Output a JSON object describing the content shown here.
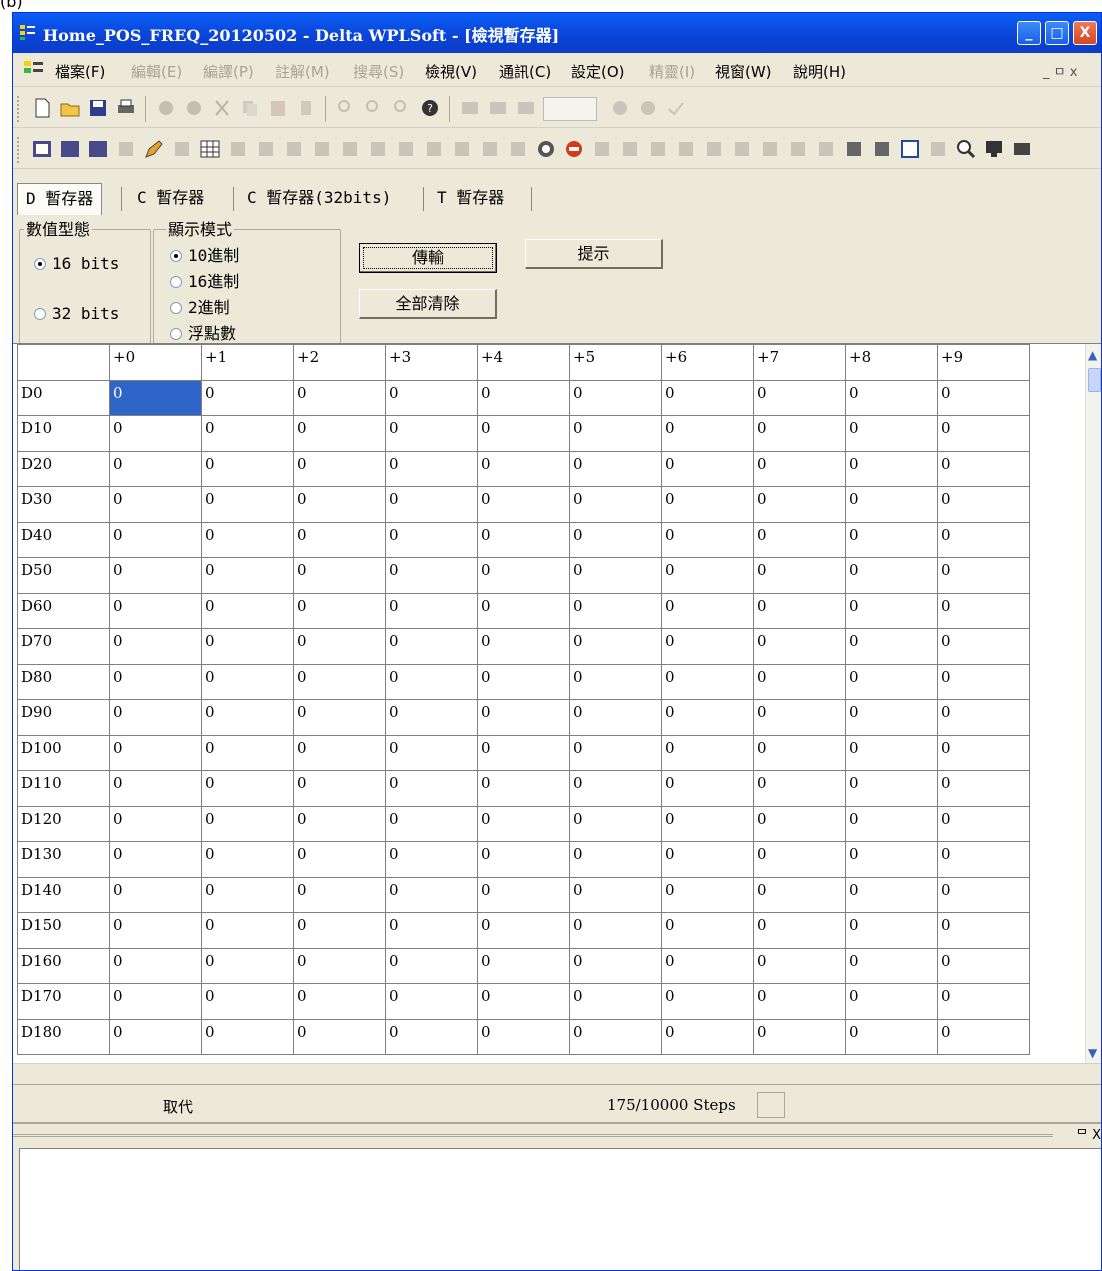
{
  "figure_label": "(b)",
  "window": {
    "title": "Home_POS_FREQ_20120502 - Delta WPLSoft - [檢視暫存器]",
    "controls": {
      "minimize": "_",
      "maximize": "□",
      "close": "X"
    }
  },
  "menu": {
    "items": [
      {
        "label": "檔案(F)",
        "enabled": true
      },
      {
        "label": "編輯(E)",
        "enabled": false
      },
      {
        "label": "編譯(P)",
        "enabled": false
      },
      {
        "label": "註解(M)",
        "enabled": false
      },
      {
        "label": "搜尋(S)",
        "enabled": false
      },
      {
        "label": "檢視(V)",
        "enabled": true
      },
      {
        "label": "通訊(C)",
        "enabled": true
      },
      {
        "label": "設定(O)",
        "enabled": true
      },
      {
        "label": "精靈(I)",
        "enabled": false
      },
      {
        "label": "視窗(W)",
        "enabled": true
      },
      {
        "label": "說明(H)",
        "enabled": true
      }
    ],
    "mdi_controls": "_ ㅁ x"
  },
  "tabs": [
    "D 暫存器",
    "C 暫存器",
    "C 暫存器(32bits)",
    "T 暫存器"
  ],
  "value_type": {
    "title": "數值型態",
    "options": [
      "16 bits",
      "32 bits"
    ],
    "selected": 0
  },
  "display_mode": {
    "title": "顯示模式",
    "options": [
      "10進制",
      "16進制",
      "2進制",
      "浮點數"
    ],
    "selected": 0
  },
  "buttons": {
    "transfer": "傳輸",
    "hint": "提示",
    "clear_all": "全部清除"
  },
  "grid": {
    "columns": [
      "+0",
      "+1",
      "+2",
      "+3",
      "+4",
      "+5",
      "+6",
      "+7",
      "+8",
      "+9"
    ],
    "rows": [
      {
        "label": "D0",
        "values": [
          "0",
          "0",
          "0",
          "0",
          "0",
          "0",
          "0",
          "0",
          "0",
          "0"
        ]
      },
      {
        "label": "D10",
        "values": [
          "0",
          "0",
          "0",
          "0",
          "0",
          "0",
          "0",
          "0",
          "0",
          "0"
        ]
      },
      {
        "label": "D20",
        "values": [
          "0",
          "0",
          "0",
          "0",
          "0",
          "0",
          "0",
          "0",
          "0",
          "0"
        ]
      },
      {
        "label": "D30",
        "values": [
          "0",
          "0",
          "0",
          "0",
          "0",
          "0",
          "0",
          "0",
          "0",
          "0"
        ]
      },
      {
        "label": "D40",
        "values": [
          "0",
          "0",
          "0",
          "0",
          "0",
          "0",
          "0",
          "0",
          "0",
          "0"
        ]
      },
      {
        "label": "D50",
        "values": [
          "0",
          "0",
          "0",
          "0",
          "0",
          "0",
          "0",
          "0",
          "0",
          "0"
        ]
      },
      {
        "label": "D60",
        "values": [
          "0",
          "0",
          "0",
          "0",
          "0",
          "0",
          "0",
          "0",
          "0",
          "0"
        ]
      },
      {
        "label": "D70",
        "values": [
          "0",
          "0",
          "0",
          "0",
          "0",
          "0",
          "0",
          "0",
          "0",
          "0"
        ]
      },
      {
        "label": "D80",
        "values": [
          "0",
          "0",
          "0",
          "0",
          "0",
          "0",
          "0",
          "0",
          "0",
          "0"
        ]
      },
      {
        "label": "D90",
        "values": [
          "0",
          "0",
          "0",
          "0",
          "0",
          "0",
          "0",
          "0",
          "0",
          "0"
        ]
      },
      {
        "label": "D100",
        "values": [
          "0",
          "0",
          "0",
          "0",
          "0",
          "0",
          "0",
          "0",
          "0",
          "0"
        ]
      },
      {
        "label": "D110",
        "values": [
          "0",
          "0",
          "0",
          "0",
          "0",
          "0",
          "0",
          "0",
          "0",
          "0"
        ]
      },
      {
        "label": "D120",
        "values": [
          "0",
          "0",
          "0",
          "0",
          "0",
          "0",
          "0",
          "0",
          "0",
          "0"
        ]
      },
      {
        "label": "D130",
        "values": [
          "0",
          "0",
          "0",
          "0",
          "0",
          "0",
          "0",
          "0",
          "0",
          "0"
        ]
      },
      {
        "label": "D140",
        "values": [
          "0",
          "0",
          "0",
          "0",
          "0",
          "0",
          "0",
          "0",
          "0",
          "0"
        ]
      },
      {
        "label": "D150",
        "values": [
          "0",
          "0",
          "0",
          "0",
          "0",
          "0",
          "0",
          "0",
          "0",
          "0"
        ]
      },
      {
        "label": "D160",
        "values": [
          "0",
          "0",
          "0",
          "0",
          "0",
          "0",
          "0",
          "0",
          "0",
          "0"
        ]
      },
      {
        "label": "D170",
        "values": [
          "0",
          "0",
          "0",
          "0",
          "0",
          "0",
          "0",
          "0",
          "0",
          "0"
        ]
      },
      {
        "label": "D180",
        "values": [
          "0",
          "0",
          "0",
          "0",
          "0",
          "0",
          "0",
          "0",
          "0",
          "0"
        ]
      }
    ],
    "selected_cell": "D0 +0"
  },
  "status": {
    "mode": "取代",
    "steps": "175/10000 Steps"
  },
  "output_panel_controls": "ᄆ X",
  "colors": {
    "titlebar": "#0b43d5",
    "chrome": "#ece9d8",
    "selection": "#2f64c9"
  }
}
